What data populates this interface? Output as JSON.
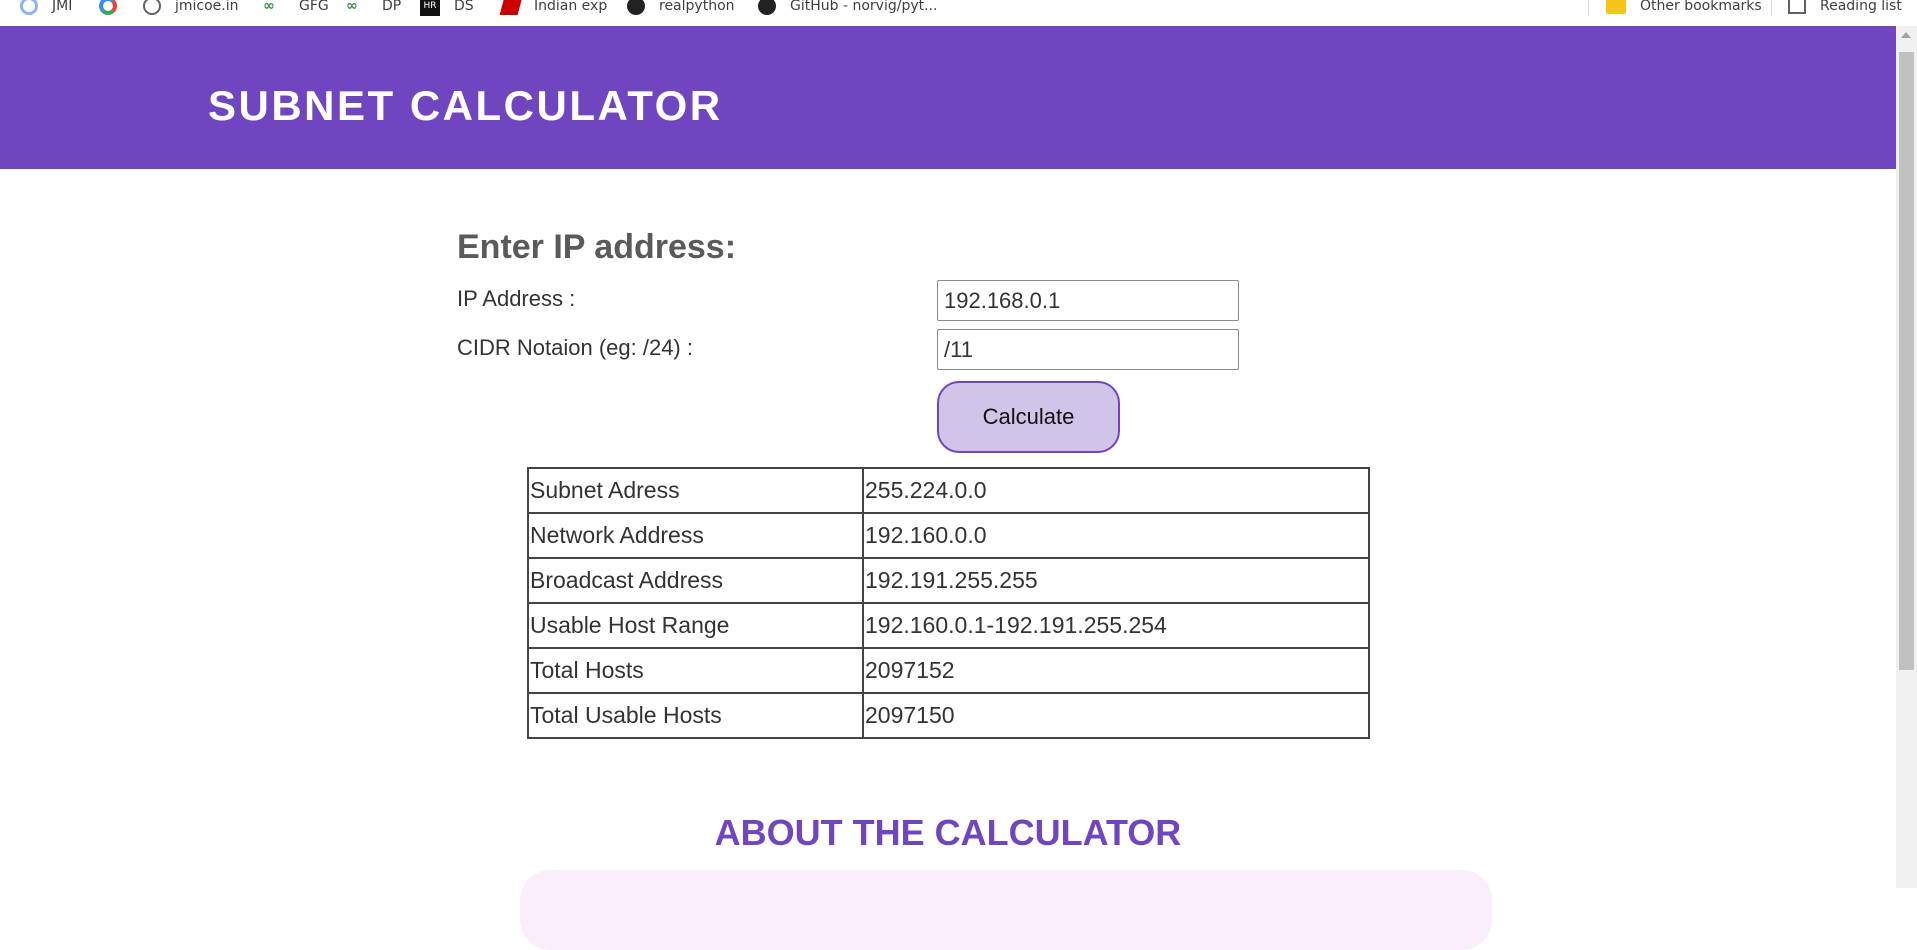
{
  "bookmarks": {
    "items": [
      {
        "label": "JMI",
        "icon": "ring-icon"
      },
      {
        "label": "",
        "icon": "google-icon"
      },
      {
        "label": "jmicoe.in",
        "icon": "globe-icon"
      },
      {
        "label": "GFG",
        "icon": "gfg-icon"
      },
      {
        "label": "DP",
        "icon": "gfg-icon"
      },
      {
        "label": "DS",
        "icon": "ds-icon"
      },
      {
        "label": "Indian exp",
        "icon": "indian-express-icon"
      },
      {
        "label": "realpython",
        "icon": "github-icon"
      },
      {
        "label": "GitHub - norvig/pyt...",
        "icon": "github-icon"
      }
    ],
    "other_bookmarks": "Other bookmarks",
    "reading_list": "Reading list"
  },
  "header": {
    "title": "SUBNET CALCULATOR",
    "bg_color": "#7045c0"
  },
  "form": {
    "heading": "Enter IP address:",
    "ip_label": "IP Address :",
    "ip_value": "192.168.0.1",
    "cidr_label": "CIDR Notaion (eg: /24) :",
    "cidr_value": "/11",
    "calculate_label": "Calculate"
  },
  "results": [
    {
      "label": "Subnet Adress",
      "value": "255.224.0.0"
    },
    {
      "label": "Network Address",
      "value": "192.160.0.0"
    },
    {
      "label": "Broadcast Address",
      "value": "192.191.255.255"
    },
    {
      "label": "Usable Host Range",
      "value": "192.160.0.1-192.191.255.254"
    },
    {
      "label": "Total Hosts",
      "value": "2097152"
    },
    {
      "label": "Total Usable Hosts",
      "value": "2097150"
    }
  ],
  "about": {
    "title": "ABOUT THE CALCULATOR"
  },
  "colors": {
    "accent": "#7045c0",
    "button_bg": "#d1c4e9",
    "about_box_bg": "#fbeefb"
  }
}
